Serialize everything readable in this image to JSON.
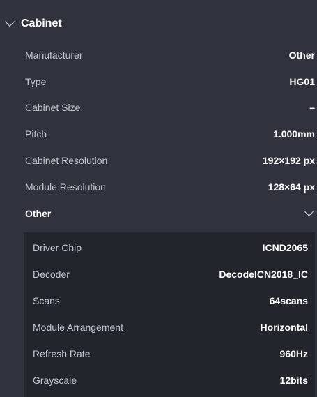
{
  "section": {
    "title": "Cabinet",
    "rows": [
      {
        "label": "Manufacturer",
        "value": "Other"
      },
      {
        "label": "Type",
        "value": "HG01"
      },
      {
        "label": "Cabinet Size",
        "value": "–"
      },
      {
        "label": "Pitch",
        "value": "1.000mm"
      },
      {
        "label": "Cabinet Resolution",
        "value": "192×192 px"
      },
      {
        "label": "Module Resolution",
        "value": "128×64 px"
      }
    ],
    "other": {
      "label": "Other",
      "rows": [
        {
          "label": "Driver Chip",
          "value": "ICND2065"
        },
        {
          "label": "Decoder",
          "value": "DecodeICN2018_IC"
        },
        {
          "label": "Scans",
          "value": "64scans"
        },
        {
          "label": "Module Arrangement",
          "value": "Horizontal"
        },
        {
          "label": "Refresh Rate",
          "value": "960Hz"
        },
        {
          "label": "Grayscale",
          "value": "12bits"
        }
      ]
    }
  }
}
